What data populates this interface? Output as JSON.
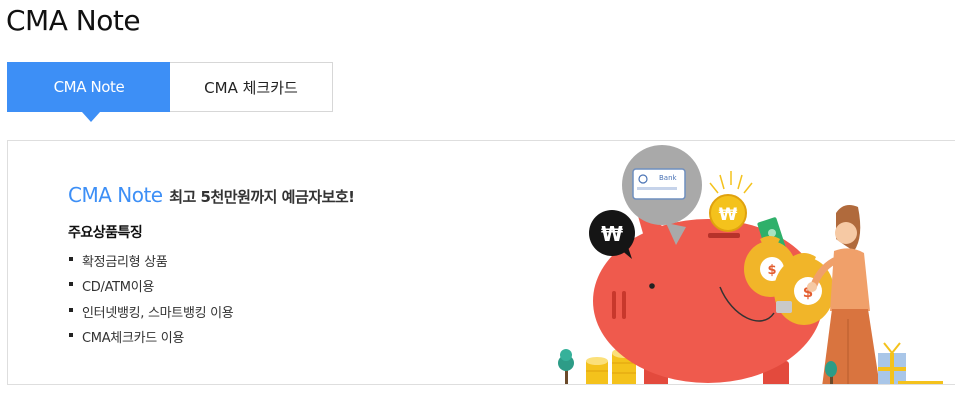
{
  "page": {
    "title": "CMA Note"
  },
  "tabs": [
    {
      "label": "CMA Note",
      "active": true
    },
    {
      "label": "CMA 체크카드",
      "active": false
    }
  ],
  "promo": {
    "brand": "CMA Note",
    "tagline": "최고 5천만원까지 예금자보호!",
    "features_heading": "주요상품특징",
    "features": [
      "확정금리형 상품",
      "CD/ATM이용",
      "인터넷뱅킹, 스마트뱅킹 이용",
      "CMA체크카드 이용"
    ]
  },
  "illustration": {
    "won_symbol": "₩",
    "bank_card_label": "Bank",
    "colors": {
      "accent": "#3d8ff6",
      "piggy": "#ef5a4d",
      "coin": "#f4c21c",
      "bubble_gray": "#a9a9a9",
      "bubble_black": "#151515"
    }
  }
}
